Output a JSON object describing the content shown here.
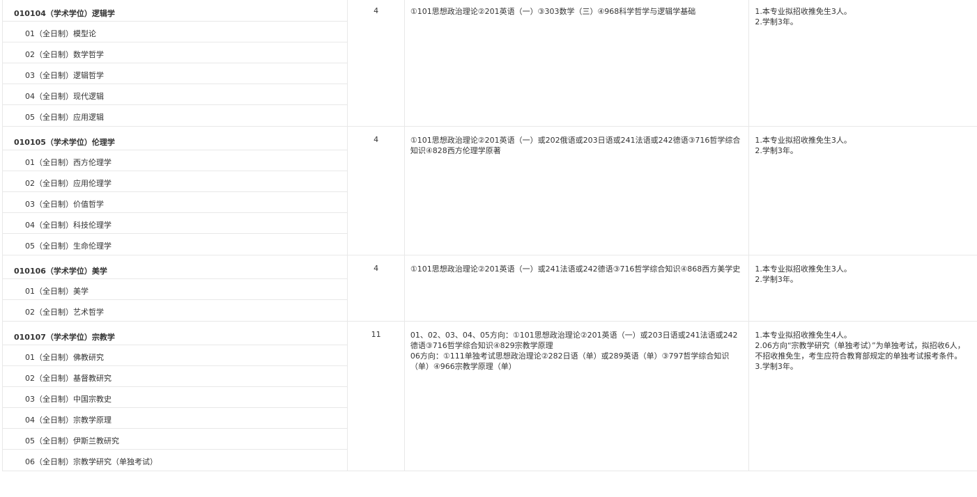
{
  "majors": [
    {
      "title": "010104（学术学位）逻辑学",
      "directions": [
        "01（全日制）模型论",
        "02（全日制）数学哲学",
        "03（全日制）逻辑哲学",
        "04（全日制）现代逻辑",
        "05（全日制）应用逻辑"
      ],
      "count": "4",
      "exam_lines": [
        "①101思想政治理论②201英语（一）③303数学（三）④968科学哲学与逻辑学基础"
      ],
      "notes_lines": [
        "1.本专业拟招收推免生3人。",
        "2.学制3年。"
      ]
    },
    {
      "title": "010105（学术学位）伦理学",
      "directions": [
        "01（全日制）西方伦理学",
        "02（全日制）应用伦理学",
        "03（全日制）价值哲学",
        "04（全日制）科技伦理学",
        "05（全日制）生命伦理学"
      ],
      "count": "4",
      "exam_lines": [
        "①101思想政治理论②201英语（一）或202俄语或203日语或241法语或242德语③716哲学综合知识④828西方伦理学原著"
      ],
      "notes_lines": [
        "1.本专业拟招收推免生3人。",
        "2.学制3年。"
      ]
    },
    {
      "title": "010106（学术学位）美学",
      "directions": [
        "01（全日制）美学",
        "02（全日制）艺术哲学"
      ],
      "count": "4",
      "exam_lines": [
        "①101思想政治理论②201英语（一）或241法语或242德语③716哲学综合知识④868西方美学史"
      ],
      "notes_lines": [
        "1.本专业拟招收推免生3人。",
        "2.学制3年。"
      ]
    },
    {
      "title": "010107（学术学位）宗教学",
      "directions": [
        "01（全日制）佛教研究",
        "02（全日制）基督教研究",
        "03（全日制）中国宗教史",
        "04（全日制）宗教学原理",
        "05（全日制）伊斯兰教研究",
        "06（全日制）宗教学研究（单独考试）"
      ],
      "count": "11",
      "exam_lines": [
        "01、02、03、04、05方向：①101思想政治理论②201英语（一）或203日语或241法语或242德语③716哲学综合知识④829宗教学原理",
        "06方向：①111单独考试思想政治理论②282日语（单）或289英语（单）③797哲学综合知识（单）④966宗教学原理（单）"
      ],
      "notes_lines": [
        "1.本专业拟招收推免生4人。",
        "2.06方向“宗教学研究（单独考试）”为单独考试，拟招收6人，不招收推免生，考生应符合教育部规定的单独考试报考条件。",
        "3.学制3年。"
      ]
    }
  ]
}
